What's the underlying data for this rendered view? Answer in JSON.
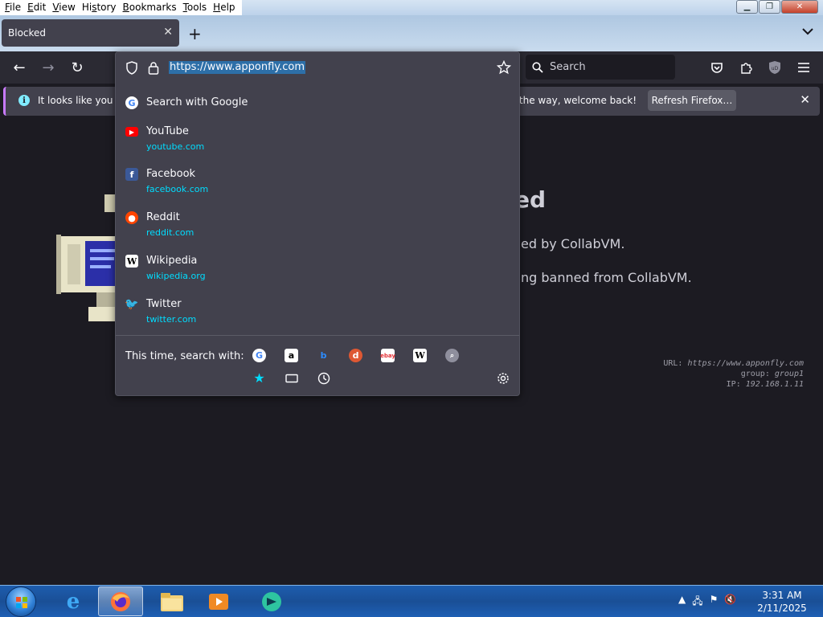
{
  "menu": {
    "items": [
      {
        "label_ul": "F",
        "label_rest": "ile"
      },
      {
        "label_ul": "E",
        "label_rest": "dit"
      },
      {
        "label_ul": "V",
        "label_rest": "iew"
      },
      {
        "label_pre": "Hi",
        "label_ul": "s",
        "label_rest": "tory"
      },
      {
        "label_ul": "B",
        "label_rest": "ookmarks"
      },
      {
        "label_ul": "T",
        "label_rest": "ools"
      },
      {
        "label_ul": "H",
        "label_rest": "elp"
      }
    ]
  },
  "tab": {
    "title": "Blocked"
  },
  "url": {
    "value": "https://www.apponfly.com"
  },
  "search": {
    "placeholder": "Search"
  },
  "notification": {
    "left_text": "It looks like you ha",
    "right_text": "y the way, welcome back!",
    "button": "Refresh Firefox…"
  },
  "page": {
    "heading": "ed",
    "line1": "ed by CollabVM.",
    "line2": "ng banned from CollabVM.",
    "meta": {
      "url_label": "URL:",
      "url_value": "https://www.apponfly.com",
      "group_label": "group:",
      "group_value": "group1",
      "ip_label": "IP:",
      "ip_value": "192.168.1.11"
    }
  },
  "suggestions": {
    "search_google": "Search with Google",
    "items": [
      {
        "title": "YouTube",
        "url": "youtube.com"
      },
      {
        "title": "Facebook",
        "url": "facebook.com"
      },
      {
        "title": "Reddit",
        "url": "reddit.com"
      },
      {
        "title": "Wikipedia",
        "url": "wikipedia.org"
      },
      {
        "title": "Twitter",
        "url": "twitter.com"
      }
    ],
    "search_with_label": "This time, search with:"
  },
  "taskbar": {
    "time": "3:31 AM",
    "date": "2/11/2025"
  },
  "colors": {
    "accent_url": "#00ddff",
    "selection": "#2d6fa8",
    "panel": "#42414d"
  }
}
